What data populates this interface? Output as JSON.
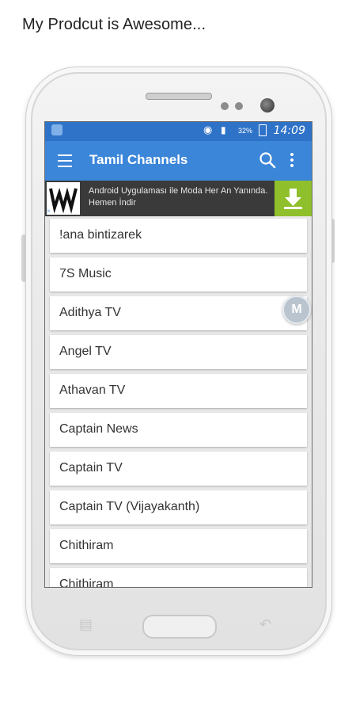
{
  "caption": "My Prodcut is Awesome...",
  "status_bar": {
    "battery_text": "32%",
    "time": "14:09",
    "icons": [
      "app-notification-icon",
      "wifi-icon",
      "signal-icon",
      "battery-icon"
    ]
  },
  "toolbar": {
    "title": "Tamil Channels",
    "icons": [
      "menu-icon",
      "search-icon",
      "more-vert-icon"
    ]
  },
  "ad": {
    "text": "Android Uygulaması ile Moda Her An Yanında. Hemen İndir",
    "close_label": "×",
    "icons": [
      "brand-logo-icon",
      "download-icon"
    ],
    "download_color": "#8fbf2a"
  },
  "channels": [
    "!ana bintizarek",
    "7S Music",
    "Adithya TV",
    "Angel TV",
    "Athavan TV",
    "Captain News",
    "Captain TV",
    "Captain TV (Vijayakanth)",
    "Chithiram",
    "Chithiram"
  ],
  "floating_badge": {
    "letter": "M"
  },
  "colors": {
    "status_bar": "#2f73c9",
    "toolbar": "#3b86d9",
    "list_background": "#e8e8e8"
  }
}
